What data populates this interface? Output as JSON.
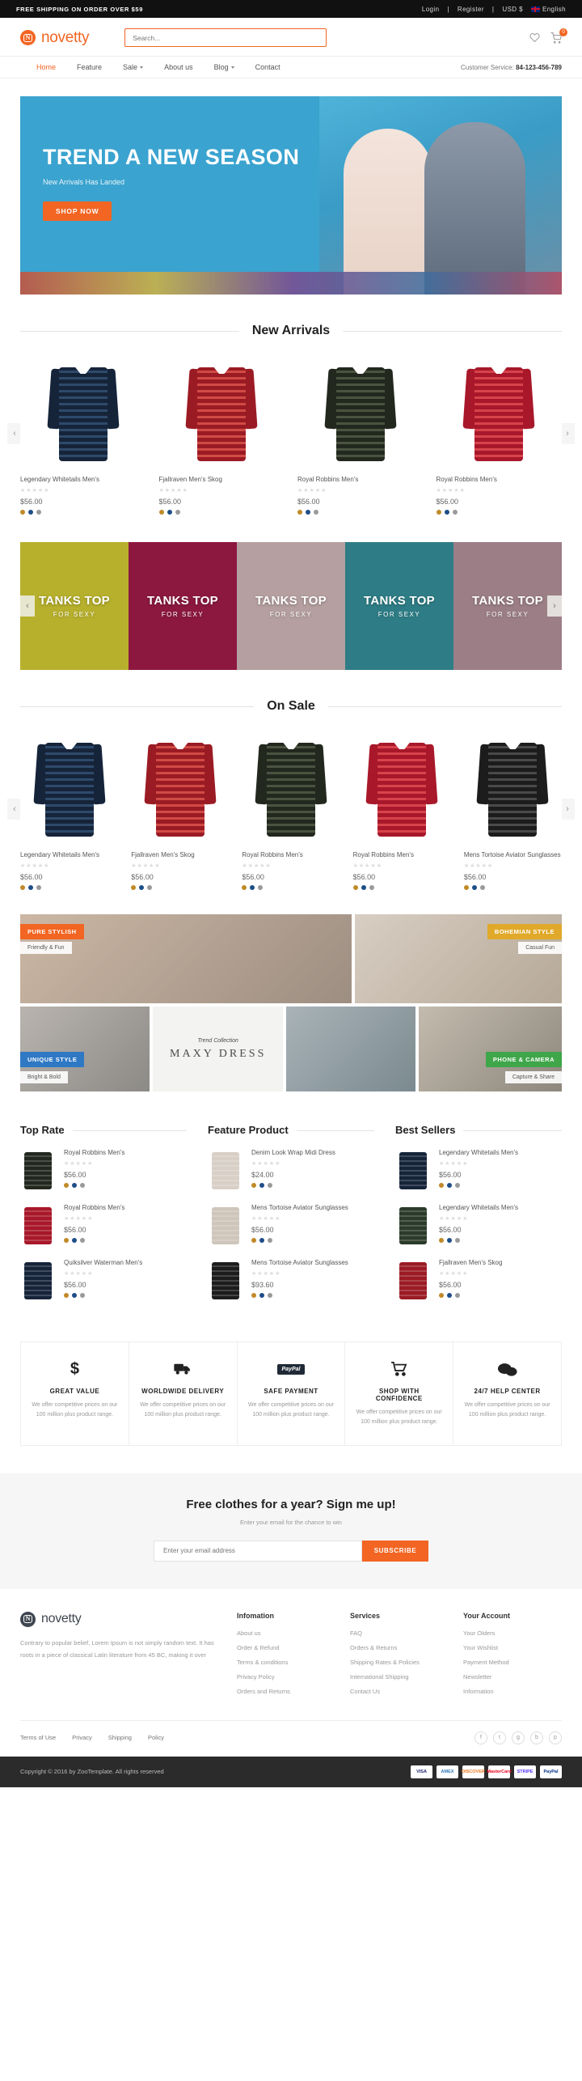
{
  "topbar": {
    "promo": "FREE SHIPPING ON ORDER OVER $59",
    "login": "Login",
    "register": "Register",
    "currency": "USD $",
    "language": "English"
  },
  "header": {
    "brand": "novetty",
    "logo_letter": "N",
    "search_placeholder": "Search...",
    "cart_count": "0"
  },
  "nav": {
    "items": [
      {
        "label": "Home",
        "caret": false
      },
      {
        "label": "Feature",
        "caret": false
      },
      {
        "label": "Sale",
        "caret": true
      },
      {
        "label": "About us",
        "caret": false
      },
      {
        "label": "Blog",
        "caret": true
      },
      {
        "label": "Contact",
        "caret": false
      }
    ],
    "customer_service_label": "Customer Service:",
    "customer_service_phone": "84-123-456-789"
  },
  "hero": {
    "title": "TREND A NEW SEASON",
    "subtitle": "New Arrivals Has Landed",
    "button": "SHOP NOW"
  },
  "new_arrivals": {
    "title": "New Arrivals",
    "products": [
      {
        "name": "Legendary Whitetails Men's",
        "price": "$56.00",
        "color_a": "#16243a",
        "color_b": "#2e4a6b",
        "color_c": "#f2f2f2"
      },
      {
        "name": "Fjallraven Men's Skog",
        "price": "$56.00",
        "color_a": "#9b1b24",
        "color_b": "#d14b46",
        "color_c": "#ffffff"
      },
      {
        "name": "Royal Robbins Men's",
        "price": "$56.00",
        "color_a": "#23281f",
        "color_b": "#4a5340",
        "color_c": "#8c2b2b"
      },
      {
        "name": "Royal Robbins Men's",
        "price": "$56.00",
        "color_a": "#a8182a",
        "color_b": "#d8434c",
        "color_c": "#1c1c1c"
      }
    ],
    "swatches": [
      "#c08a28",
      "#1f4e87",
      "#9a9a9a"
    ]
  },
  "tanks": {
    "items": [
      {
        "title": "TANKS TOP",
        "sub": "FOR SEXY",
        "bg": "#b7b02c"
      },
      {
        "title": "TANKS TOP",
        "sub": "FOR SEXY",
        "bg": "#8c1840"
      },
      {
        "title": "TANKS TOP",
        "sub": "FOR SEXY",
        "bg": "#b59fa0"
      },
      {
        "title": "TANKS TOP",
        "sub": "FOR SEXY",
        "bg": "#2e7d86"
      },
      {
        "title": "TANKS TOP",
        "sub": "FOR SEXY",
        "bg": "#9c7f86"
      }
    ]
  },
  "on_sale": {
    "title": "On Sale",
    "products": [
      {
        "name": "Legendary Whitetails Men's",
        "price": "$56.00",
        "color_a": "#16243a",
        "color_b": "#2e4a6b",
        "color_c": "#f2f2f2"
      },
      {
        "name": "Fjallraven Men's Skog",
        "price": "$56.00",
        "color_a": "#9b1b24",
        "color_b": "#d14b46",
        "color_c": "#ffffff"
      },
      {
        "name": "Royal Robbins Men's",
        "price": "$56.00",
        "color_a": "#23281f",
        "color_b": "#4a5340",
        "color_c": "#8c2b2b"
      },
      {
        "name": "Royal Robbins Men's",
        "price": "$56.00",
        "color_a": "#a8182a",
        "color_b": "#d8434c",
        "color_c": "#1c1c1c"
      },
      {
        "name": "Mens Tortoise Aviator Sunglasses",
        "price": "$56.00",
        "color_a": "#1c1c1c",
        "color_b": "#4a4a4a",
        "color_c": "#8a7a5a"
      }
    ]
  },
  "lookbook": {
    "tiles": [
      {
        "tag": "PURE STYLISH",
        "tag_color": "#f26522",
        "sub": "Friendly & Fun"
      },
      {
        "tag": "BOHEMIAN STYLE",
        "tag_color": "#e0a92a",
        "sub": "Casual Fun"
      },
      {
        "tag": "UNIQUE STYLE",
        "tag_color": "#2f78c4",
        "sub": "Bright & Bold"
      },
      {
        "tag": "PHONE & CAMERA",
        "tag_color": "#3fa64a",
        "sub": "Capture & Share"
      }
    ],
    "center": {
      "s1": "Trend Collection",
      "s2": "MAXY DRESS"
    }
  },
  "columns": [
    {
      "title": "Top Rate",
      "items": [
        {
          "name": "Royal Robbins Men's",
          "price": "$56.00",
          "color": "#23281f"
        },
        {
          "name": "Royal Robbins Men's",
          "price": "$56.00",
          "color": "#a8182a"
        },
        {
          "name": "Quiksilver Waterman Men's",
          "price": "$56.00",
          "color": "#16243a"
        }
      ]
    },
    {
      "title": "Feature Product",
      "items": [
        {
          "name": "Denim Look Wrap Midi Dress",
          "price": "$24.00",
          "color": "#d8cfc6"
        },
        {
          "name": "Mens Tortoise Aviator Sunglasses",
          "price": "$56.00",
          "color": "#cfc6bb"
        },
        {
          "name": "Mens Tortoise Aviator Sunglasses",
          "price": "$93.60",
          "color": "#1c1c1c"
        }
      ]
    },
    {
      "title": "Best Sellers",
      "items": [
        {
          "name": "Legendary Whitetails Men's",
          "price": "$56.00",
          "color": "#16243a"
        },
        {
          "name": "Legendary Whitetails Men's",
          "price": "$56.00",
          "color": "#2b3b2a"
        },
        {
          "name": "Fjallraven Men's Skog",
          "price": "$56.00",
          "color": "#9b1b24"
        }
      ]
    }
  ],
  "services": [
    {
      "icon": "dollar-icon",
      "glyph": "$",
      "title": "GREAT VALUE",
      "text": "We offer competitive prices on our 100 million plus product range."
    },
    {
      "icon": "truck-icon",
      "glyph": "",
      "title": "WORLDWIDE DELIVERY",
      "text": "We offer competitive prices on our 100 million plus product range."
    },
    {
      "icon": "paypal-icon",
      "glyph": "PayPal",
      "title": "SAFE PAYMENT",
      "text": "We offer competitive prices on our 100 million plus product range."
    },
    {
      "icon": "cart-icon",
      "glyph": "",
      "title": "SHOP WITH CONFIDENCE",
      "text": "We offer competitive prices on our 100 million plus product range."
    },
    {
      "icon": "chat-icon",
      "glyph": "",
      "title": "24/7 HELP CENTER",
      "text": "We offer competitive prices on our 100 million plus product range."
    }
  ],
  "newsletter": {
    "title": "Free clothes for a year? Sign me up!",
    "subtitle": "Enter your email for the chance to win",
    "placeholder": "Enter your email address",
    "button": "SUBSCRIBE"
  },
  "footer": {
    "brand": "novetty",
    "about": "Contrary to popular belief, Lorem Ipsum is not simply random text. It has roots in a piece of classical Latin literature from 45 BC, making it over",
    "columns": [
      {
        "title": "Infomation",
        "links": [
          "About us",
          "Order & Refund",
          "Terms & conditions",
          "Privacy Policy",
          "Orders and Returns"
        ]
      },
      {
        "title": "Services",
        "links": [
          "FAQ",
          "Orders & Returns",
          "Shipping Rates & Policies",
          "International Shipping",
          "Contact Us"
        ]
      },
      {
        "title": "Your Account",
        "links": [
          "Your Olders",
          "Your Wishlist",
          "Payment Method",
          "Newsletter",
          "Information"
        ]
      }
    ],
    "bottom_links": [
      "Terms of Use",
      "Privacy",
      "Shipping",
      "Policy"
    ],
    "socials": [
      "f",
      "t",
      "g",
      "b",
      "p"
    ],
    "copyright": "Copyright © 2016 by ZooTemplate. All rights reserved",
    "payments": [
      "VISA",
      "AMEX",
      "DISCOVER",
      "MasterCard",
      "STRIPE",
      "PayPal"
    ]
  }
}
